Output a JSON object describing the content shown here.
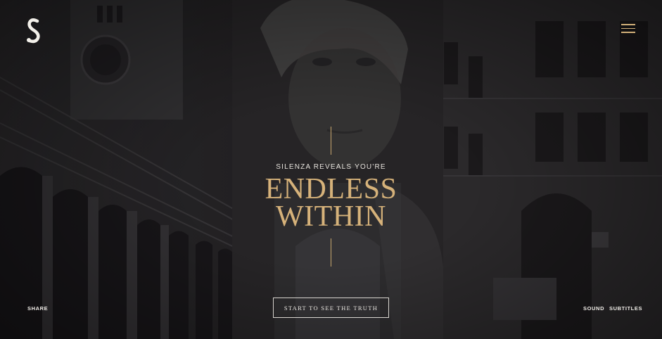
{
  "header": {
    "logo_icon": "silenza-s-logo-icon",
    "menu_icon": "hamburger-menu-icon"
  },
  "hero": {
    "kicker": "SILENZA REVEALS YOU'RE",
    "headline_line1": "ENDLESS",
    "headline_line2": "WITHIN",
    "cta_label": "START TO SEE THE TRUTH"
  },
  "footer": {
    "share_label": "SHARE",
    "sound_label": "SOUND",
    "subtitles_label": "SUBTITLES"
  },
  "colors": {
    "accent_gold": "#d6b27a",
    "text_light": "#efece7",
    "background": "#232224"
  }
}
